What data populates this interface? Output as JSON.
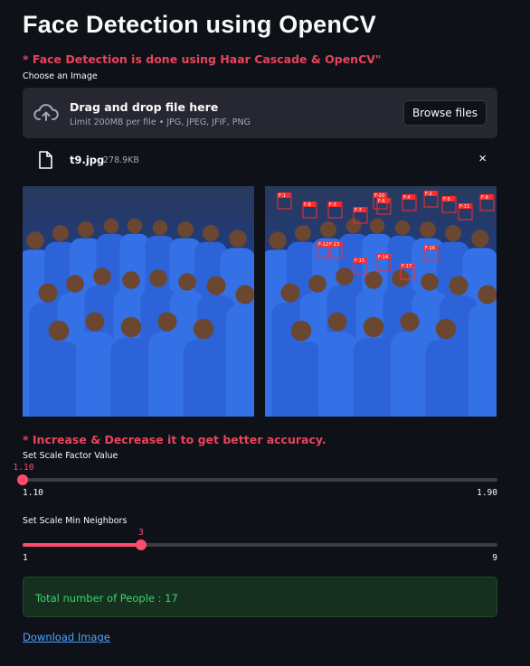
{
  "page": {
    "title": "Face Detection using OpenCV",
    "note": "* Face Detection is done using Haar Cascade & OpenCV\"",
    "choose_label": "Choose an Image"
  },
  "uploader": {
    "title": "Drag and drop file here",
    "limit": "Limit 200MB per file • JPG, JPEG, JFIF, PNG",
    "browse_label": "Browse files",
    "file_name": "t9.jpg",
    "file_size": "278.9KB",
    "close_icon": "×"
  },
  "images": {
    "face_labels": [
      "F-1",
      "F-2",
      "F-3",
      "F-4",
      "F-5",
      "F-6",
      "F-7",
      "F-8",
      "F-9",
      "F-10",
      "F-11",
      "F-12",
      "F-13",
      "F-14",
      "F-15",
      "F-16",
      "F-17"
    ]
  },
  "accuracy_note": "* Increase & Decrease it to get better accuracy.",
  "scale_factor": {
    "label": "Set Scale Factor Value",
    "value": "1.10",
    "min": "1.10",
    "max": "1.90",
    "fraction": 0.0
  },
  "min_neighbors": {
    "label": "Set Scale Min Neighbors",
    "value": "3",
    "min": "1",
    "max": "9",
    "fraction": 0.25
  },
  "result": {
    "text": "Total number of People : 17"
  },
  "download": {
    "label": "Download Image"
  },
  "colors": {
    "accent": "#ff4b6b",
    "note": "#e8445a",
    "success_text": "#3dd56d",
    "link": "#4da3ff",
    "face_box": "#ff2b2b"
  }
}
